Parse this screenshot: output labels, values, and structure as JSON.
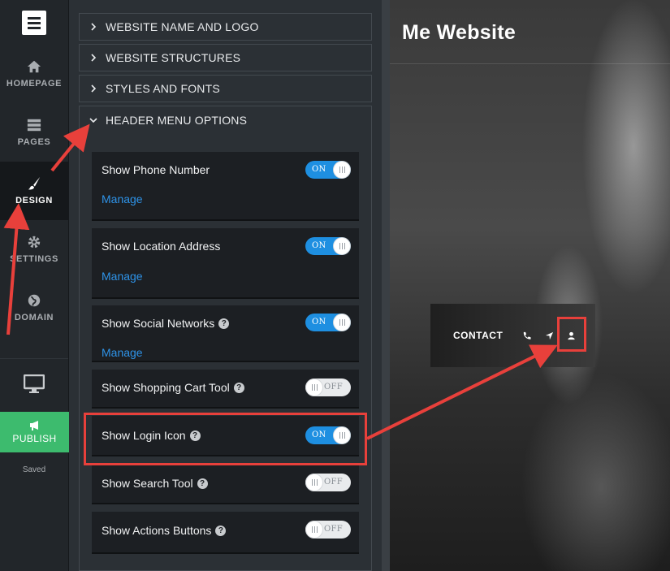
{
  "nav": {
    "items": [
      {
        "label": "HOMEPAGE",
        "icon": "home-icon",
        "active": false
      },
      {
        "label": "PAGES",
        "icon": "pages-icon",
        "active": false
      },
      {
        "label": "DESIGN",
        "icon": "brush-icon",
        "active": true
      },
      {
        "label": "SETTINGS",
        "icon": "gear-icon",
        "active": false
      },
      {
        "label": "DOMAIN",
        "icon": "globe-icon",
        "active": false
      }
    ],
    "publish_label": "PUBLISH",
    "saved_label": "Saved"
  },
  "panel": {
    "sections": [
      {
        "label": "WEBSITE NAME AND LOGO",
        "expanded": false
      },
      {
        "label": "WEBSITE STRUCTURES",
        "expanded": false
      },
      {
        "label": "STYLES AND FONTS",
        "expanded": false
      },
      {
        "label": "HEADER MENU OPTIONS",
        "expanded": true
      }
    ],
    "options": [
      {
        "label": "Show Phone Number",
        "state": "ON",
        "manage": "Manage",
        "help": false
      },
      {
        "label": "Show Location Address",
        "state": "ON",
        "manage": "Manage",
        "help": false
      },
      {
        "label": "Show Social Networks",
        "state": "ON",
        "manage": "Manage",
        "help": true
      },
      {
        "label": "Show Shopping Cart Tool",
        "state": "OFF",
        "help": true
      },
      {
        "label": "Show Login Icon",
        "state": "ON",
        "help": true
      },
      {
        "label": "Show Search Tool",
        "state": "OFF",
        "help": true
      },
      {
        "label": "Show Actions Buttons",
        "state": "OFF",
        "help": true
      }
    ],
    "help_glyph": "?"
  },
  "preview": {
    "site_title": "Me Website",
    "menu_contact": "CONTACT"
  },
  "colors": {
    "accent_blue": "#1e8fe1",
    "publish_green": "#3dbb6e",
    "annotation_red": "#e8403b"
  }
}
